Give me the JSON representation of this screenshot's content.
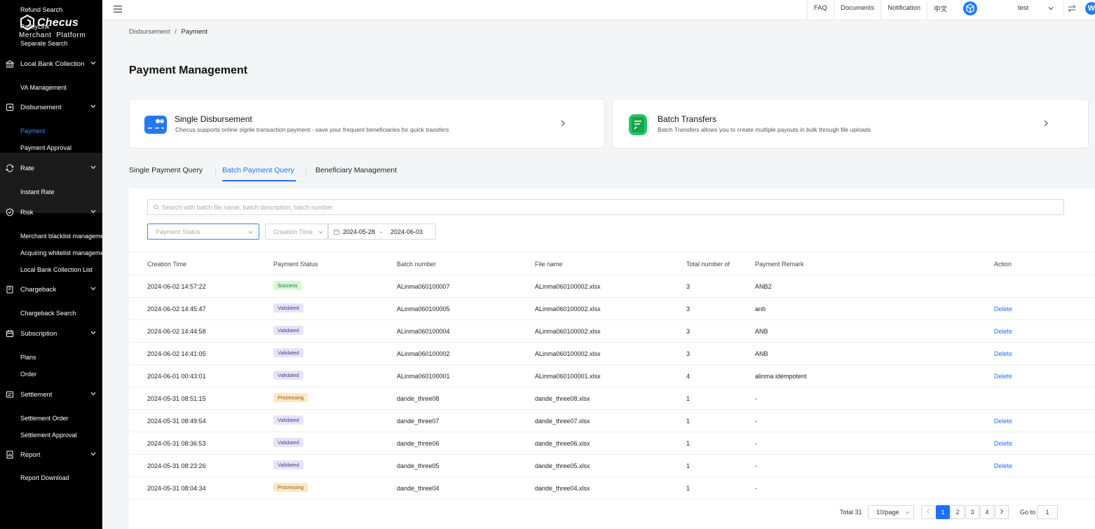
{
  "brand": {
    "name": "Checus",
    "subtitle": "Merchant  Platform"
  },
  "sidebar": {
    "items": [
      {
        "type": "item",
        "label": "Refund Search"
      },
      {
        "type": "item",
        "label": "PaybyLink"
      },
      {
        "type": "item",
        "label": "Separate Search"
      },
      {
        "type": "group",
        "label": "Local Bank Collection",
        "icon": "bank-icon"
      },
      {
        "type": "item",
        "label": "VA Management"
      },
      {
        "type": "group",
        "label": "Disbursement",
        "icon": "disbursement-icon"
      },
      {
        "type": "item",
        "label": "Payment",
        "active": true
      },
      {
        "type": "item",
        "label": "Payment Approval"
      },
      {
        "type": "group",
        "label": "Rate",
        "icon": "refresh-icon"
      },
      {
        "type": "item",
        "label": "Instant Rate"
      },
      {
        "type": "group",
        "label": "Risk",
        "icon": "shield-icon"
      },
      {
        "type": "item",
        "label": "Merchant blacklist management"
      },
      {
        "type": "item",
        "label": "Acquiring whitelist management"
      },
      {
        "type": "item",
        "label": "Local Bank Collection List"
      },
      {
        "type": "group",
        "label": "Chargeback",
        "icon": "chargeback-icon"
      },
      {
        "type": "item",
        "label": "Chargeback Search"
      },
      {
        "type": "group",
        "label": "Subscription",
        "icon": "subscription-icon"
      },
      {
        "type": "item",
        "label": "Plans"
      },
      {
        "type": "item",
        "label": "Order"
      },
      {
        "type": "group",
        "label": "Settlement",
        "icon": "settlement-icon"
      },
      {
        "type": "item",
        "label": "Settlement Order"
      },
      {
        "type": "item",
        "label": "Settlement Approval"
      },
      {
        "type": "group",
        "label": "Report",
        "icon": "report-icon"
      },
      {
        "type": "item",
        "label": "Report Download"
      }
    ]
  },
  "header": {
    "links": [
      "FAQ",
      "Documents",
      "Notification",
      "中文"
    ],
    "user": "test",
    "app_badge": "W"
  },
  "breadcrumb": {
    "parent": "Disbursement",
    "separator": "/",
    "current": "Payment"
  },
  "page_title": "Payment Management",
  "cards": [
    {
      "title": "Single Disbursement",
      "desc": "Checus supports online signle transaction payment - save your frequent beneficiaries for quick transfers",
      "icon": "card-icon",
      "color": "#2478f2"
    },
    {
      "title": "Batch Transfers",
      "desc": "Batch Transfers allows you to create multiple payouts in bulk through file uploads",
      "icon": "document-icon",
      "color": "#22c55e"
    }
  ],
  "tabs": [
    {
      "label": "Single Payment Query"
    },
    {
      "label": "Batch Payment Query",
      "active": true
    },
    {
      "label": "Beneficiary Management"
    }
  ],
  "filters": {
    "search_placeholder": "Search with batch file name, batch description, batch number",
    "status_placeholder": "Payment Status",
    "time_type": "Creation Time",
    "date_start": "2024-05-28",
    "date_sep": "-",
    "date_end": "2024-06-03"
  },
  "table": {
    "columns": [
      "Creation Time",
      "Payment Status",
      "Batch number",
      "File name",
      "Total number of",
      "Payment Remark",
      "Action"
    ],
    "rows": [
      {
        "time": "2024-06-02 14:57:22",
        "status": "Success",
        "batch": "ALinma060100007",
        "file": "ALinma060100002.xlsx",
        "total": "3",
        "remark": "ANB2",
        "action": ""
      },
      {
        "time": "2024-06-02 14:45:47",
        "status": "Validated",
        "batch": "ALinma060100005",
        "file": "ALinma060100002.xlsx",
        "total": "3",
        "remark": "anb",
        "action": "Delete"
      },
      {
        "time": "2024-06-02 14:44:58",
        "status": "Validated",
        "batch": "ALinma060100004",
        "file": "ALinma060100002.xlsx",
        "total": "3",
        "remark": "ANB",
        "action": "Delete"
      },
      {
        "time": "2024-06-02 14:41:05",
        "status": "Validated",
        "batch": "ALinma060100002",
        "file": "ALinma060100002.xlsx",
        "total": "3",
        "remark": "ANB",
        "action": "Delete"
      },
      {
        "time": "2024-06-01 00:43:01",
        "status": "Validated",
        "batch": "ALinma060100001",
        "file": "ALinma060100001.xlsx",
        "total": "4",
        "remark": "alinma idempotent",
        "action": "Delete"
      },
      {
        "time": "2024-05-31 08:51:15",
        "status": "Processing",
        "batch": "dande_three08",
        "file": "dande_three08.xlsx",
        "total": "1",
        "remark": "-",
        "action": ""
      },
      {
        "time": "2024-05-31 08:49:54",
        "status": "Validated",
        "batch": "dande_three07",
        "file": "dande_three07.xlsx",
        "total": "1",
        "remark": "-",
        "action": "Delete"
      },
      {
        "time": "2024-05-31 08:36:53",
        "status": "Validated",
        "batch": "dande_three06",
        "file": "dande_three06.xlsx",
        "total": "1",
        "remark": "-",
        "action": "Delete"
      },
      {
        "time": "2024-05-31 08:23:26",
        "status": "Validated",
        "batch": "dande_three05",
        "file": "dande_three05.xlsx",
        "total": "1",
        "remark": "-",
        "action": "Delete"
      },
      {
        "time": "2024-05-31 08:04:34",
        "status": "Processing",
        "batch": "dande_three04",
        "file": "dande_three04.xlsx",
        "total": "1",
        "remark": "-",
        "action": ""
      }
    ]
  },
  "pagination": {
    "total": "Total 31",
    "page_size": "10/page",
    "pages": [
      "1",
      "2",
      "3",
      "4"
    ],
    "current": "1",
    "goto_label": "Go to",
    "goto_value": "1"
  }
}
